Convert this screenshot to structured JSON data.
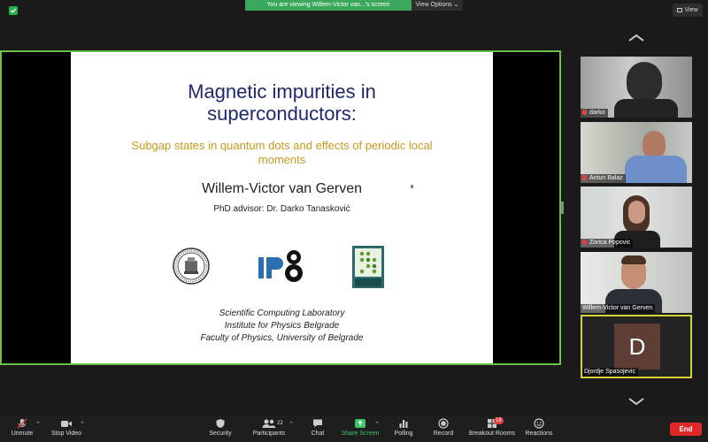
{
  "top": {
    "banner": "You are viewing Willem-Victor van...'s screen",
    "view_options": "View Options",
    "view_button": "View"
  },
  "slide": {
    "title_line1": "Magnetic impurities in",
    "title_line2": "superconductors:",
    "subtitle_line1": "Subgap states in quantum dots and effects of periodic local",
    "subtitle_line2": "moments",
    "author": "Willem-Victor van Gerven",
    "advisor": "PhD advisor: Dr. Darko Tanasković",
    "logo_ipb_text": "IPB",
    "logo_scl_text": "SCIENTIFIC COMPUTING LABORATORY",
    "aff_line1": "Scientific Computing Laboratory",
    "aff_line2": "Institute for Physics Belgrade",
    "aff_line3": "Faculty of Physics, University of Belgrade",
    "colors": {
      "title": "#1e2a6e",
      "subtitle": "#c59a1e"
    }
  },
  "participants": [
    {
      "name": "darko",
      "muted": true
    },
    {
      "name": "Antun Balaz",
      "muted": true
    },
    {
      "name": "Zorica Popovic",
      "muted": true
    },
    {
      "name": "Willem-Victor van Gerven",
      "muted": false
    },
    {
      "name": "Djordje Spasojevic",
      "muted": false,
      "avatar_letter": "D"
    }
  ],
  "toolbar": {
    "unmute": "Unmute",
    "stop_video": "Stop Video",
    "security": "Security",
    "participants": "Participants",
    "participants_count": "22",
    "chat": "Chat",
    "share_screen": "Share Screen",
    "polling": "Polling",
    "record": "Record",
    "breakout": "Breakout Rooms",
    "breakout_badge": "18",
    "reactions": "Reactions",
    "end": "End"
  }
}
